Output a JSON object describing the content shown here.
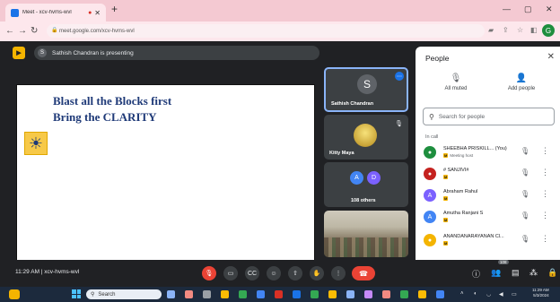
{
  "browser": {
    "tab_title": "Meet - xcv-hvms-wvl",
    "new_tab": "+",
    "url": "meet.google.com/xcv-hvms-wvl",
    "profile_initial": "G"
  },
  "meet": {
    "presenting_initial": "S",
    "presenting_text": "Sathish Chandran is presenting",
    "slide": {
      "line1": "Blast all the Blocks first",
      "line2": "Bring the CLARITY"
    },
    "tiles": [
      {
        "initial": "S",
        "name": "Sathish Chandran"
      },
      {
        "name": "Kitty Maya"
      },
      {
        "initials": [
          "A",
          "D"
        ],
        "name": "108 others",
        "colors": [
          "#4285f4",
          "#7b61ff"
        ]
      }
    ],
    "meeting_time": "11:29 AM",
    "meeting_code": "xcv-hvms-wvl",
    "participant_count": "108"
  },
  "people_panel": {
    "title": "People",
    "all_muted": "All muted",
    "add_people": "Add people",
    "search_placeholder": "Search for people",
    "in_call": "In call",
    "participants": [
      {
        "name": "SHEEBHA PRISKILL...",
        "suffix": "(You)",
        "badge": "Meeting host",
        "color": "#1e8e3e",
        "initial": ""
      },
      {
        "name": "# SANJIVI#",
        "badge": "",
        "color": "#c5221f",
        "initial": ""
      },
      {
        "name": "Abraham Rahul",
        "badge": "",
        "color": "#7b61ff",
        "initial": "A"
      },
      {
        "name": "Amutha Ranjani S",
        "badge": "",
        "color": "#4285f4",
        "initial": "A"
      },
      {
        "name": "ANANDANARAYANAN Cl...",
        "badge": "",
        "color": "#f4b400",
        "initial": ""
      }
    ]
  },
  "taskbar": {
    "search_label": "Search",
    "time": "11:29 AM",
    "date": "5/3/2024"
  }
}
